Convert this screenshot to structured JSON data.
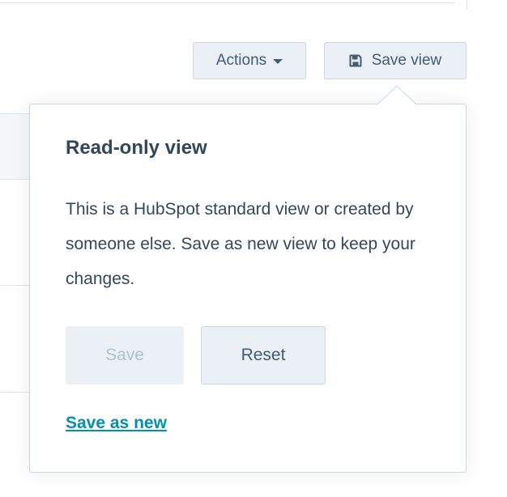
{
  "toolbar": {
    "actions_label": "Actions",
    "save_view_label": "Save view"
  },
  "popover": {
    "title": "Read-only view",
    "body": "This is a HubSpot standard view or created by someone else. Save as new view to keep your changes.",
    "save_label": "Save",
    "reset_label": "Reset",
    "save_as_new_label": "Save as new"
  },
  "colors": {
    "link": "#0091ae",
    "button_bg": "#eaf0f6",
    "border": "#cbd6e2",
    "text": "#33475b",
    "disabled_text": "#b0c1d4"
  },
  "icons": {
    "actions_caret": "caret-down-icon",
    "save_view": "floppy-disk-icon"
  }
}
